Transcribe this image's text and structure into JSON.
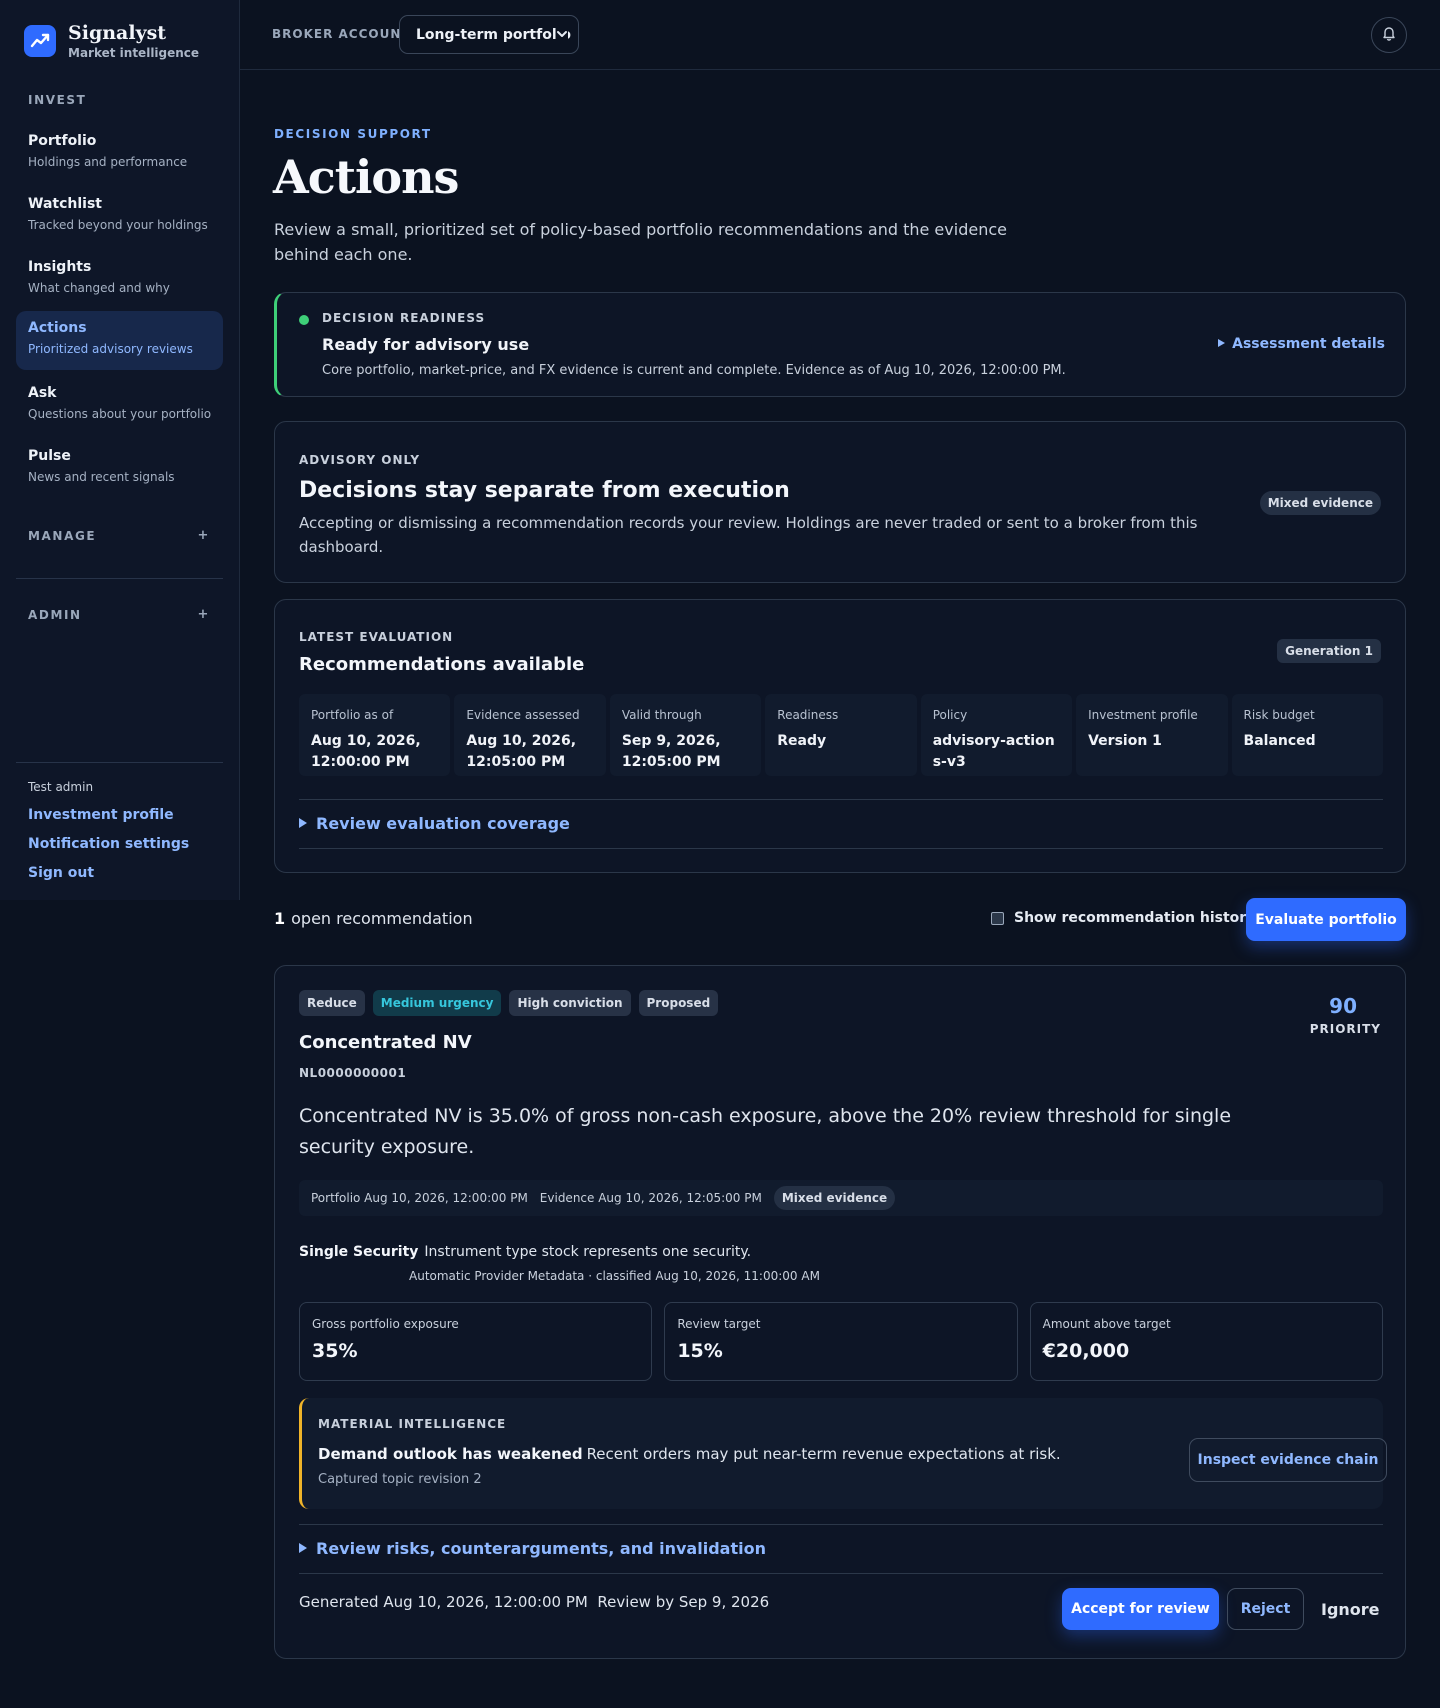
{
  "brand": {
    "name": "Signalyst",
    "tagline": "Market intelligence"
  },
  "sidebar": {
    "sections": {
      "invest": "INVEST",
      "manage": "MANAGE",
      "admin": "ADMIN",
      "expand_symbol": "+"
    },
    "items": [
      {
        "label": "Portfolio",
        "desc": "Holdings and performance"
      },
      {
        "label": "Watchlist",
        "desc": "Tracked beyond your holdings"
      },
      {
        "label": "Insights",
        "desc": "What changed and why"
      },
      {
        "label": "Actions",
        "desc": "Prioritized advisory reviews",
        "active": true
      },
      {
        "label": "Ask",
        "desc": "Questions about your portfolio"
      },
      {
        "label": "Pulse",
        "desc": "News and recent signals"
      }
    ],
    "user": "Test admin",
    "links": {
      "profile": "Investment profile",
      "notifications": "Notification settings",
      "signout": "Sign out"
    }
  },
  "topbar": {
    "broker_label": "BROKER ACCOUNT",
    "broker_value": "Long-term portfolio"
  },
  "page": {
    "eyebrow": "DECISION SUPPORT",
    "title": "Actions",
    "description": "Review a small, prioritized set of policy-based portfolio recommendations and the evidence behind each one."
  },
  "readiness": {
    "eyebrow": "DECISION READINESS",
    "title": "Ready for advisory use",
    "description": "Core portfolio, market-price, and FX evidence is current and complete. Evidence as of Aug 10, 2026, 12:00:00 PM.",
    "link": "Assessment details",
    "status_color": "#3ecf78"
  },
  "advisory": {
    "eyebrow": "ADVISORY ONLY",
    "title": "Decisions stay separate from execution",
    "description": "Accepting or dismissing a recommendation records your review. Holdings are never traded or sent to a broker from this dashboard.",
    "badge": "Mixed evidence"
  },
  "evaluation": {
    "eyebrow": "LATEST EVALUATION",
    "title": "Recommendations available",
    "badge": "Generation 1",
    "fields": [
      {
        "label": "Portfolio as of",
        "value": "Aug 10, 2026, 12:00:00 PM"
      },
      {
        "label": "Evidence assessed",
        "value": "Aug 10, 2026, 12:05:00 PM"
      },
      {
        "label": "Valid through",
        "value": "Sep 9, 2026, 12:05:00 PM"
      },
      {
        "label": "Readiness",
        "value": "Ready"
      },
      {
        "label": "Policy",
        "value": "advisory-actions-v3"
      },
      {
        "label": "Investment profile",
        "value": "Version 1"
      },
      {
        "label": "Risk budget",
        "value": "Balanced"
      }
    ],
    "coverage_link": "Review evaluation coverage"
  },
  "list": {
    "count": "1",
    "count_label": "open recommendation",
    "history_label": "Show recommendation history",
    "evaluate_button": "Evaluate portfolio"
  },
  "recommendation": {
    "tags": {
      "action": "Reduce",
      "urgency": "Medium urgency",
      "conviction": "High conviction",
      "status": "Proposed"
    },
    "priority": "90",
    "priority_label": "PRIORITY",
    "title": "Concentrated NV",
    "isin": "NL0000000001",
    "summary": "Concentrated NV is 35.0% of gross non-cash exposure, above the 20% review threshold for single security exposure.",
    "meta": {
      "portfolio": "Portfolio Aug 10, 2026, 12:00:00 PM",
      "evidence": "Evidence Aug 10, 2026, 12:05:00 PM",
      "badge": "Mixed evidence"
    },
    "classification": {
      "label": "Single Security",
      "text": "Instrument type stock represents one security.",
      "source": "Automatic Provider Metadata · classified Aug 10, 2026, 11:00:00 AM"
    },
    "metrics": [
      {
        "label": "Gross portfolio exposure",
        "value": "35%"
      },
      {
        "label": "Review target",
        "value": "15%"
      },
      {
        "label": "Amount above target",
        "value": "€20,000"
      }
    ],
    "intel": {
      "eyebrow": "MATERIAL INTELLIGENCE",
      "headline": "Demand outlook has weakened",
      "text": "Recent orders may put near-term revenue expectations at risk.",
      "sub": "Captured topic revision 2",
      "button": "Inspect evidence chain",
      "accent": "#f0b429"
    },
    "risks_link": "Review risks, counterarguments, and invalidation",
    "generated": "Generated Aug 10, 2026, 12:00:00 PM",
    "review_by": "Review by Sep 9, 2026",
    "buttons": {
      "accept": "Accept for review",
      "reject": "Reject",
      "ignore": "Ignore"
    }
  },
  "colors": {
    "accent": "#2f6bff",
    "link": "#8fb8ff",
    "urgency": "#36c6dc",
    "background": "#0b1220"
  }
}
